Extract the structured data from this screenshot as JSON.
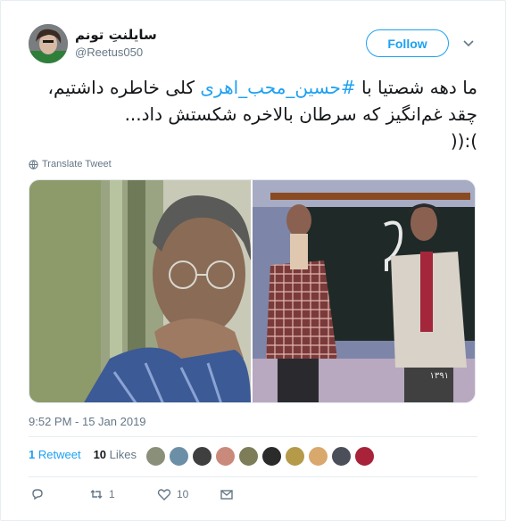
{
  "user": {
    "display_name": "سایلنتِ تونم",
    "handle": "@Reetus050"
  },
  "follow_label": "Follow",
  "tweet": {
    "text_before": "ما دهه شصتیا با ",
    "hashtag": "#حسین_محب_اهری",
    "text_after": " کلی خاطره داشتیم،",
    "line2": "چقد غم‌انگیز که سرطان بالاخره شکستش داد...",
    "line3": "):(("
  },
  "translate_label": "Translate Tweet",
  "timestamp": "9:52 PM - 15 Jan 2019",
  "stats": {
    "retweets_count": "1",
    "retweets_label": "Retweet",
    "likes_count": "10",
    "likes_label": "Likes"
  },
  "likers_colors": [
    "#8a8f7a",
    "#6c8fa8",
    "#3f3f3f",
    "#c98a7b",
    "#7d7d5a",
    "#2b2b2b",
    "#b59a4a",
    "#d9a86c",
    "#4a4f5a",
    "#a8223a"
  ],
  "actions": {
    "reply_count": "",
    "retweet_count": "1",
    "like_count": "10"
  },
  "media_caption": "۱۳۹۱",
  "colors": {
    "accent": "#1da1f2",
    "secondary_text": "#657786",
    "border": "#e6ecf0"
  }
}
